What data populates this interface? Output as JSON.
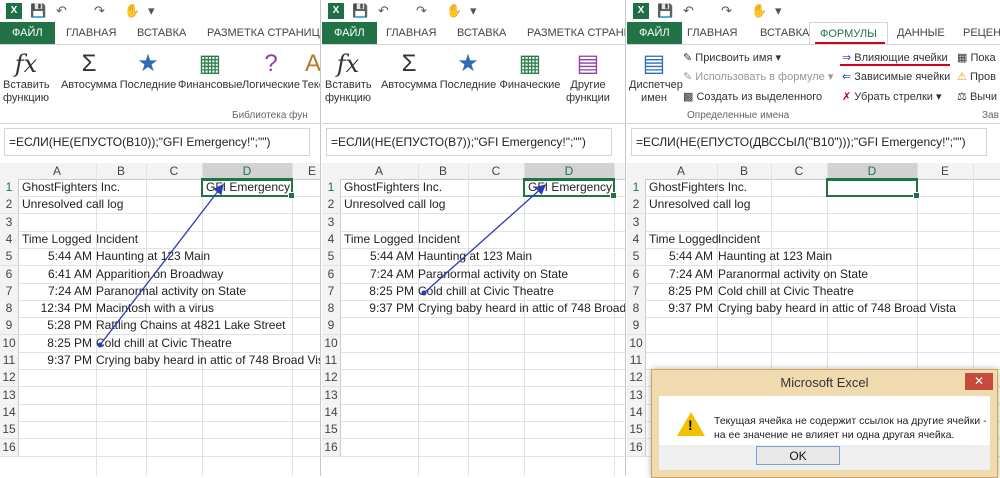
{
  "tabs": {
    "file": "ФАЙЛ",
    "home": "ГЛАВНАЯ",
    "insert": "ВСТАВКА",
    "layout": "РАЗМЕТКА СТРАНИЦЫ",
    "layout_short": "РАЗМЕТКА СТРАНИ",
    "formulas": "ФОРМУЛЫ",
    "data": "ДАННЫЕ",
    "review": "РЕЦЕНЗ"
  },
  "ribbon": {
    "insert_function": "Вставить функцию",
    "autosum": "Автосумма",
    "recent": "Последние",
    "financial": "Финансовые",
    "financial2": "Финачеcкие",
    "logical": "Логические",
    "text": "Текс",
    "other_functions": "Другие функции",
    "library_label": "Библиотека фун",
    "name_manager": "Диспетчер имен",
    "define_name": "Присвоить имя",
    "use_in_formula": "Использовать в формуле",
    "create_from_selection": "Создать из выделенного",
    "defined_names_label": "Определенные имена",
    "trace_precedents": "Влияющие ячейки",
    "trace_dependents": "Зависимые ячейки",
    "remove_arrows": "Убрать стрелки",
    "show": "Пока",
    "check": "Пров",
    "calc": "Вычи",
    "dep_label": "Зав"
  },
  "formulas": {
    "p1": "=ЕСЛИ(НЕ(ЕПУСТО(B10));\"GFI Emergency!\";\"\")",
    "p2": "=ЕСЛИ(НЕ(ЕПУСТО(B7));\"GFI Emergency!\";\"\")",
    "p3": "=ЕСЛИ(НЕ(ЕПУСТО(ДВССЫЛ(\"B10\")));\"GFI Emergency!\";\"\")"
  },
  "columns": [
    "A",
    "B",
    "C",
    "D",
    "E"
  ],
  "rows": [
    "1",
    "2",
    "3",
    "4",
    "5",
    "6",
    "7",
    "8",
    "9",
    "10",
    "11",
    "12",
    "13",
    "14",
    "15",
    "16"
  ],
  "sheet1": {
    "company": "GhostFighters Inc.",
    "log": "Unresolved call log",
    "h_time": "Time Logged",
    "h_incident": "Incident",
    "d1": "GFI Emergency!",
    "times": [
      "5:44 AM",
      "6:41 AM",
      "7:24 AM",
      "12:34 PM",
      "5:28 PM",
      "8:25 PM",
      "9:37 PM"
    ],
    "incidents": [
      "Haunting at 123 Main",
      "Apparition on Broadway",
      "Paranormal activity on State",
      "Macintosh with a virus",
      "Rattling Chains at 4821 Lake Street",
      "Cold chill at Civic Theatre",
      "Crying baby heard in attic of 748 Broad Vist"
    ]
  },
  "sheet2": {
    "d1": "GFI Emergency!",
    "times": [
      "5:44 AM",
      "7:24 AM",
      "8:25 PM",
      "9:37 PM"
    ],
    "incidents": [
      "Haunting at 123 Main",
      "Paranormal activity on State",
      "Cold chill at Civic Theatre",
      "Crying baby heard in attic of 748 Broad V"
    ]
  },
  "sheet3": {
    "incidents": [
      "Haunting at 123 Main",
      "Paranormal activity on State",
      "Cold chill at Civic Theatre",
      "Crying baby heard in attic of 748 Broad Vista"
    ]
  },
  "dialog": {
    "title": "Microsoft Excel",
    "line1": "Текущая ячейка не содержит ссылок на другие ячейки -",
    "line2": "на ее значение не влияет ни одна другая ячейка.",
    "ok": "OK",
    "close": "✕"
  },
  "colors": {
    "excel_green": "#217346",
    "highlight": "#d0021b",
    "arrow": "#2a3bb8"
  }
}
